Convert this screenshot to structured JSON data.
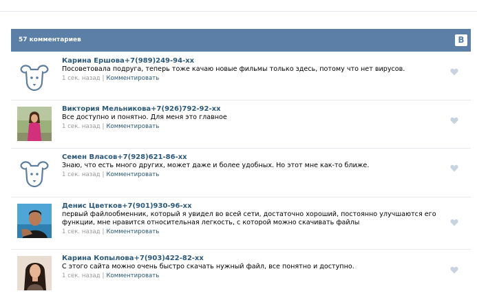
{
  "header": {
    "count_label": "57 комментариев",
    "logo_letter": "В"
  },
  "comments": [
    {
      "name": "Карина  Ершова+7(989)249-94-хх",
      "text": "Посоветовала подруга, теперь тоже качаю новые фильмы только здесь, потому что нет вирусов.",
      "time": "1 сек. назад",
      "separator": "|",
      "reply_label": "Комментировать",
      "avatar": "default-dog-avatar"
    },
    {
      "name": "Виктория  Мельникова+7(926)792-92-хх",
      "text": "Все доступно и понятно. Для меня это главное",
      "time": "1 сек. назад",
      "separator": "|",
      "reply_label": "Комментировать",
      "avatar": "photo-avatar"
    },
    {
      "name": "Семен  Власов+7(928)621-86-хх",
      "text": "Знаю, что есть много других, может даже и более удобных. Но этот мне как-то ближе.",
      "time": "1 сек. назад",
      "separator": "|",
      "reply_label": "Комментировать",
      "avatar": "default-dog-avatar"
    },
    {
      "name": "Денис  Цветков+7(901)930-96-хх",
      "text": "первый файлообменник, который я увидел во всей сети, достаточно хороший, постоянно улучшаются его функции, мне нравится относительная легкость, с которой можно скачивать файлы",
      "time": "1 сек. назад",
      "separator": "|",
      "reply_label": "Комментировать",
      "avatar": "photo-avatar"
    },
    {
      "name": "Карина  Копылова+7(903)422-82-хх",
      "text": "С этого сайта можно очень быстро скачать нужный файл, все понятно и доступно.",
      "time": "1 сек. назад",
      "separator": "|",
      "reply_label": "Комментировать",
      "avatar": "photo-avatar"
    }
  ],
  "colors": {
    "header_bg": "#5b7fa6",
    "link": "#2b587a",
    "meta": "#999999",
    "like": "#c7d3e0"
  }
}
